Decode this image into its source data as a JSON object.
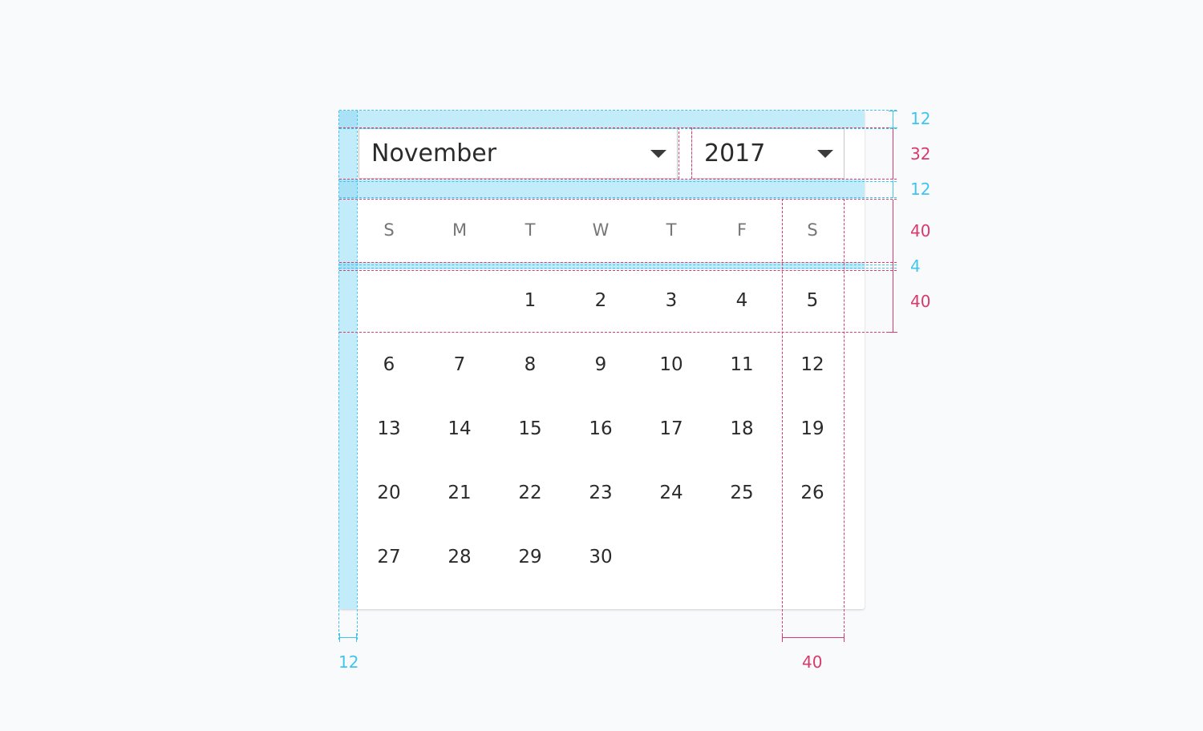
{
  "picker": {
    "month": "November",
    "year": "2017",
    "weekdays": [
      "S",
      "M",
      "T",
      "W",
      "T",
      "F",
      "S"
    ],
    "weeks": [
      [
        "",
        "",
        "1",
        "2",
        "3",
        "4",
        "5"
      ],
      [
        "6",
        "7",
        "8",
        "9",
        "10",
        "11",
        "12"
      ],
      [
        "13",
        "14",
        "15",
        "16",
        "17",
        "18",
        "19"
      ],
      [
        "20",
        "21",
        "22",
        "23",
        "24",
        "25",
        "26"
      ],
      [
        "27",
        "28",
        "29",
        "30",
        "",
        "",
        ""
      ]
    ]
  },
  "annotations": {
    "top_padding": "12",
    "select_height": "32",
    "select_gap": "12",
    "weekday_row_height": "40",
    "row_gap": "4",
    "day_row_height": "40",
    "left_padding": "12",
    "column_width": "40"
  },
  "colors": {
    "spacing_annotation": "#40c4f0",
    "size_annotation": "#d83a6a",
    "text": "#2b2b2b",
    "weekday_text": "#767676"
  },
  "icons": {
    "dropdown": "triangle-down"
  }
}
